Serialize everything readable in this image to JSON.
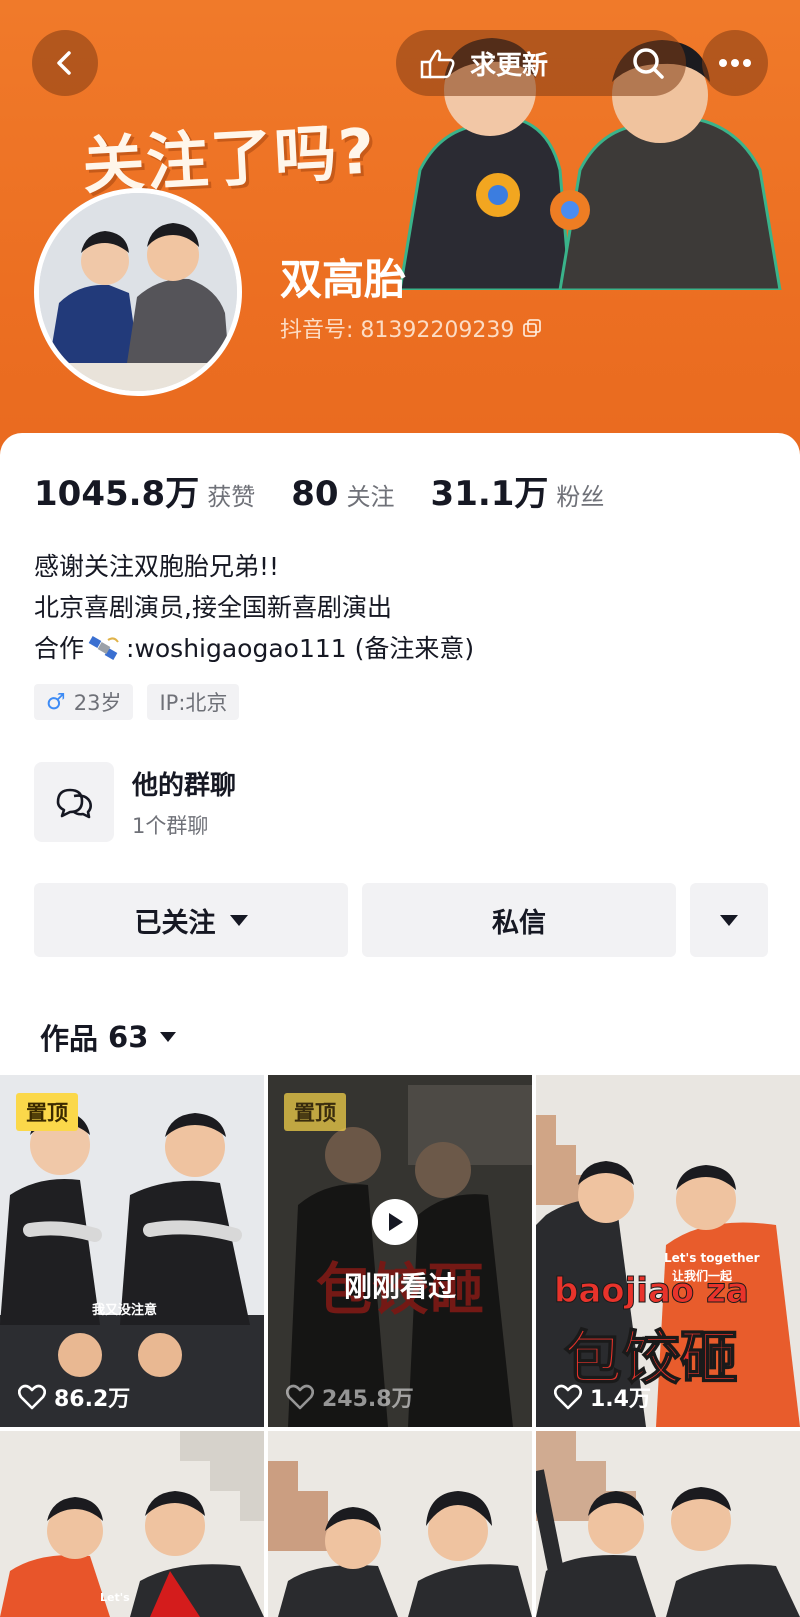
{
  "header": {
    "back_icon": "chevron-left-icon",
    "pill_label": "求更新",
    "pill_icon": "hand-point-icon",
    "search_icon": "search-icon",
    "more_icon": "more-dots-icon",
    "banner_slogan": "关注了吗?"
  },
  "profile": {
    "nickname": "双高胎",
    "douyin_id": "抖音号: 81392209239",
    "copy_icon": "copy-icon"
  },
  "stats": [
    {
      "value": "1045.8万",
      "label": "获赞"
    },
    {
      "value": "80",
      "label": "关注"
    },
    {
      "value": "31.1万",
      "label": "粉丝"
    }
  ],
  "bio": {
    "line1": "感谢关注双胞胎兄弟!!",
    "line2": "北京喜剧演员,接全国新喜剧演出",
    "line3_prefix": "合作",
    "line3_suffix": ":woshigaogao111 (备注来意)"
  },
  "tags": {
    "gender_symbol": "♂",
    "age": "23岁",
    "ip": "IP:北京"
  },
  "group": {
    "title": "他的群聊",
    "subtitle": "1个群聊"
  },
  "actions": {
    "follow_label": "已关注",
    "message_label": "私信"
  },
  "works": {
    "tab_label": "作品",
    "count": "63"
  },
  "videos": [
    {
      "pinned": true,
      "pin_label": "置顶",
      "likes": "86.2万",
      "caption": "我又没注意"
    },
    {
      "pinned": true,
      "pin_label": "置顶",
      "likes": "245.8万",
      "watched": true,
      "watched_label": "刚刚看过",
      "overlay_text": "包饺砸"
    },
    {
      "pinned": false,
      "likes": "1.4万",
      "overlay_en": "baojiao za",
      "overlay_cn": "包饺砸",
      "tag_en": "Let's together",
      "tag_cn": "让我们一起"
    },
    {
      "pinned": false,
      "tag_en": "Let's"
    },
    {
      "pinned": false
    },
    {
      "pinned": false
    }
  ],
  "colors": {
    "banner": "#ec6f22",
    "pin_bg": "#fbd84a",
    "accent_red": "#e8332b",
    "male_blue": "#3d8bf5"
  }
}
